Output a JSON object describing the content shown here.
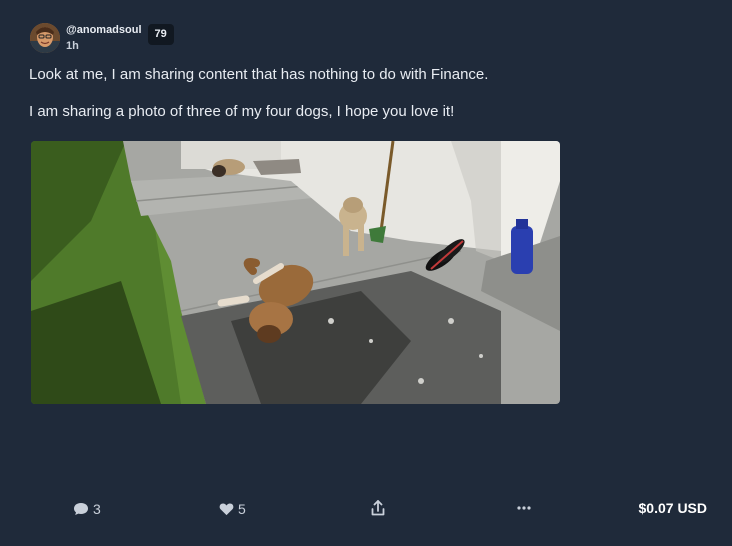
{
  "post": {
    "author": {
      "username": "@anomadsoul",
      "level": "79",
      "time_ago": "1h"
    },
    "paragraphs": [
      "Look at me, I am sharing content that has nothing to do with Finance.",
      "I am sharing a photo of three of my four dogs, I hope you love it!"
    ],
    "image": {
      "icon": "photo-of-dogs"
    },
    "actions": {
      "comments_count": "3",
      "likes_count": "5",
      "share_icon": "share-icon",
      "more_icon": "more-icon",
      "payout": "$0.07 USD"
    }
  },
  "colors": {
    "background": "#1f2a3a",
    "badge_bg": "#111821",
    "text": "#e8ecf2"
  }
}
